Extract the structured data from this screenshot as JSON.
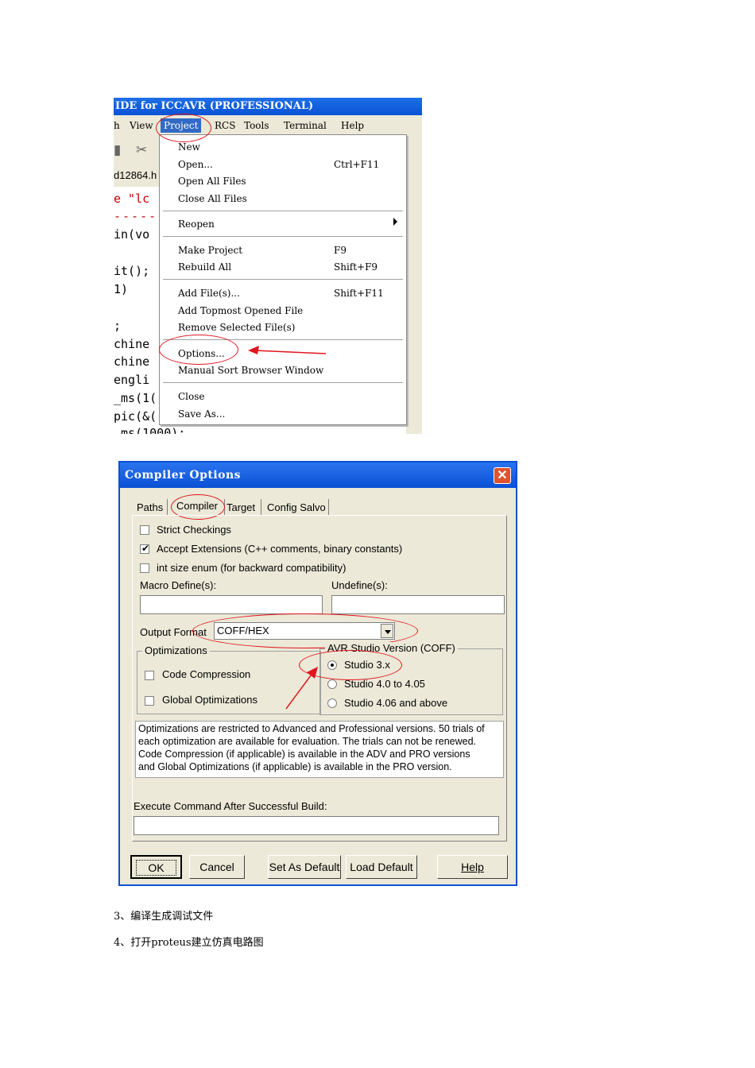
{
  "ide": {
    "title": "IDE for ICCAVR (PROFESSIONAL)",
    "menubar": [
      "h",
      "View",
      "Project",
      "RCS",
      "Tools",
      "Terminal",
      "Help"
    ],
    "tab_label": "d12864.h",
    "code_lines": [
      "e \"lc",
      "-----",
      "in(vo",
      "it();",
      "1)",
      ";",
      "chine",
      "chine",
      "engli",
      "_ms(1(",
      "pic(&(",
      "_ms(1000);"
    ],
    "project_menu": {
      "items": [
        {
          "label": "New",
          "shortcut": ""
        },
        {
          "label": "Open...",
          "shortcut": "Ctrl+F11"
        },
        {
          "label": "Open All Files",
          "shortcut": ""
        },
        {
          "label": "Close All Files",
          "shortcut": ""
        },
        {
          "label": "Reopen",
          "shortcut": ""
        },
        {
          "label": "Make Project",
          "shortcut": "F9"
        },
        {
          "label": "Rebuild All",
          "shortcut": "Shift+F9"
        },
        {
          "label": "Add File(s)...",
          "shortcut": "Shift+F11"
        },
        {
          "label": "Add Topmost Opened File",
          "shortcut": ""
        },
        {
          "label": "Remove Selected File(s)",
          "shortcut": ""
        },
        {
          "label": "Options...",
          "shortcut": ""
        },
        {
          "label": "Manual Sort Browser Window",
          "shortcut": ""
        },
        {
          "label": "Close",
          "shortcut": ""
        },
        {
          "label": "Save As...",
          "shortcut": ""
        }
      ]
    }
  },
  "dialog": {
    "title": "Compiler Options",
    "close_glyph": "✕",
    "tabs": [
      "Paths",
      "Compiler",
      "Target",
      "Config Salvo"
    ],
    "strict_checkings": "Strict Checkings",
    "accept_extensions": "Accept Extensions (C++ comments, binary constants)",
    "int_size_enum": "int size enum (for backward compatibility)",
    "macro_define_label": "Macro Define(s):",
    "undefine_label": "Undefine(s):",
    "output_format_label": "Output Format",
    "output_format_value": "COFF/HEX",
    "optimizations_label": "Optimizations",
    "code_compression": "Code Compression",
    "global_optimizations": "Global Optimizations",
    "avr_studio_label": "AVR Studio Version (COFF)",
    "studio_options": [
      "Studio 3.x",
      "Studio 4.0 to 4.05",
      "Studio 4.06 and above"
    ],
    "info_text": [
      "Optimizations are restricted to Advanced and Professional versions. 50 trials of",
      "each optimization are available for evaluation. The trials can not be renewed.",
      "Code Compression (if applicable) is available in the ADV and PRO versions",
      "and Global Optimizations (if applicable) is available in the PRO version."
    ],
    "execute_label": "Execute Command After Successful Build:",
    "buttons": [
      "OK",
      "Cancel",
      "Set As Default",
      "Load Default",
      "Help"
    ]
  },
  "captions": [
    "3、编译生成调试文件",
    "4、打开proteus建立仿真电路图"
  ],
  "colors": {
    "annotation_red": "#e0151d",
    "titlebar_blue": "#0b50d5",
    "xp_face": "#ece9d8"
  }
}
